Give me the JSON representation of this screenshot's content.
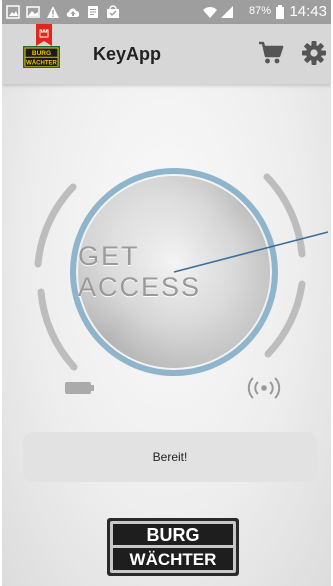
{
  "status_bar": {
    "battery_percent": "87%",
    "time": "14:43"
  },
  "app_bar": {
    "title": "KeyApp",
    "logo_text": [
      "BURG",
      "WÄCHTER"
    ],
    "actions": [
      "cart-icon",
      "gear-icon"
    ]
  },
  "access": {
    "button_label": "GET ACCESS"
  },
  "status": {
    "message": "Bereit!"
  },
  "footer": {
    "logo_text": [
      "BURG",
      "WÄCHTER"
    ]
  },
  "colors": {
    "app_bar": "#d7d7d7",
    "status_bar": "#9e9e9e",
    "ring_accent": "#8fb5cc",
    "brand_red": "#e1261c",
    "brand_yellow": "#f2c200",
    "brand_green": "#1f6b35"
  }
}
